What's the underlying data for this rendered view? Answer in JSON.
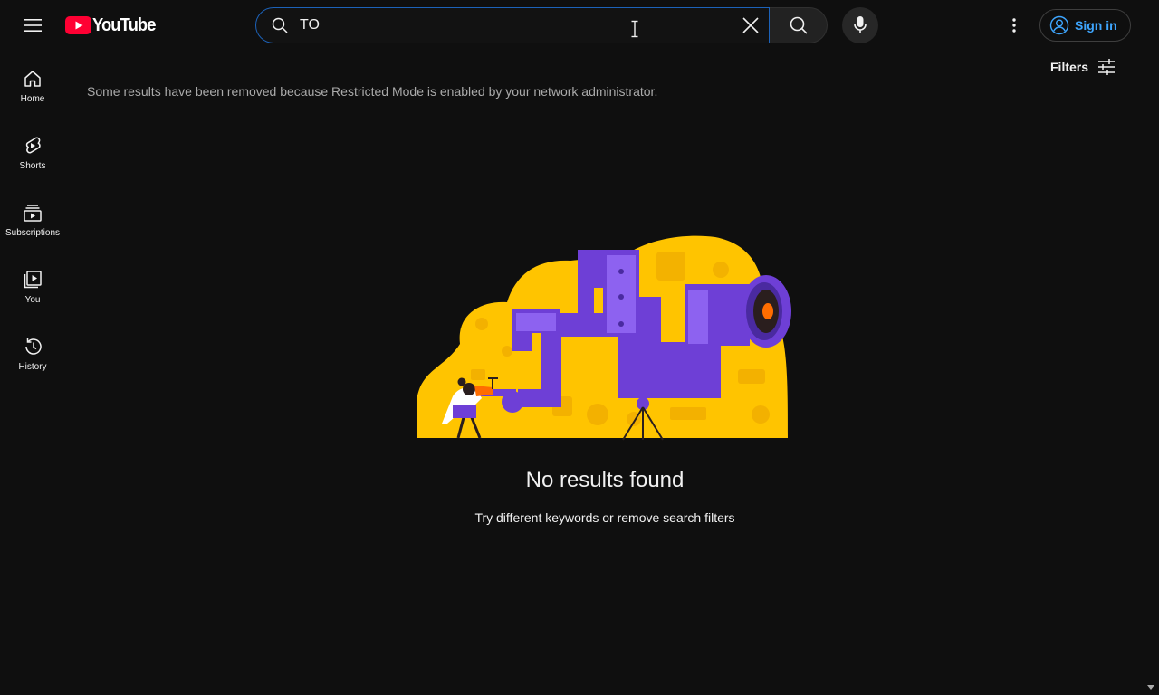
{
  "header": {
    "logo_text": "YouTube",
    "search_value": "TO",
    "search_placeholder": "Search",
    "signin_label": "Sign in"
  },
  "guide": {
    "items": [
      {
        "label": "Home",
        "icon": "home-icon"
      },
      {
        "label": "Shorts",
        "icon": "shorts-icon"
      },
      {
        "label": "Subscriptions",
        "icon": "subscriptions-icon"
      },
      {
        "label": "You",
        "icon": "you-icon"
      },
      {
        "label": "History",
        "icon": "history-icon"
      }
    ]
  },
  "results": {
    "notice": "Some results have been removed because Restricted Mode is enabled by your network administrator.",
    "filters_label": "Filters",
    "empty_title": "No results found",
    "empty_subtitle": "Try different keywords or remove search filters"
  },
  "colors": {
    "background": "#0f0f0f",
    "accent_blue": "#3ea6ff",
    "brand_red": "#ff0033",
    "illustration_yellow": "#ffc400",
    "illustration_purple": "#6e3fd6"
  }
}
